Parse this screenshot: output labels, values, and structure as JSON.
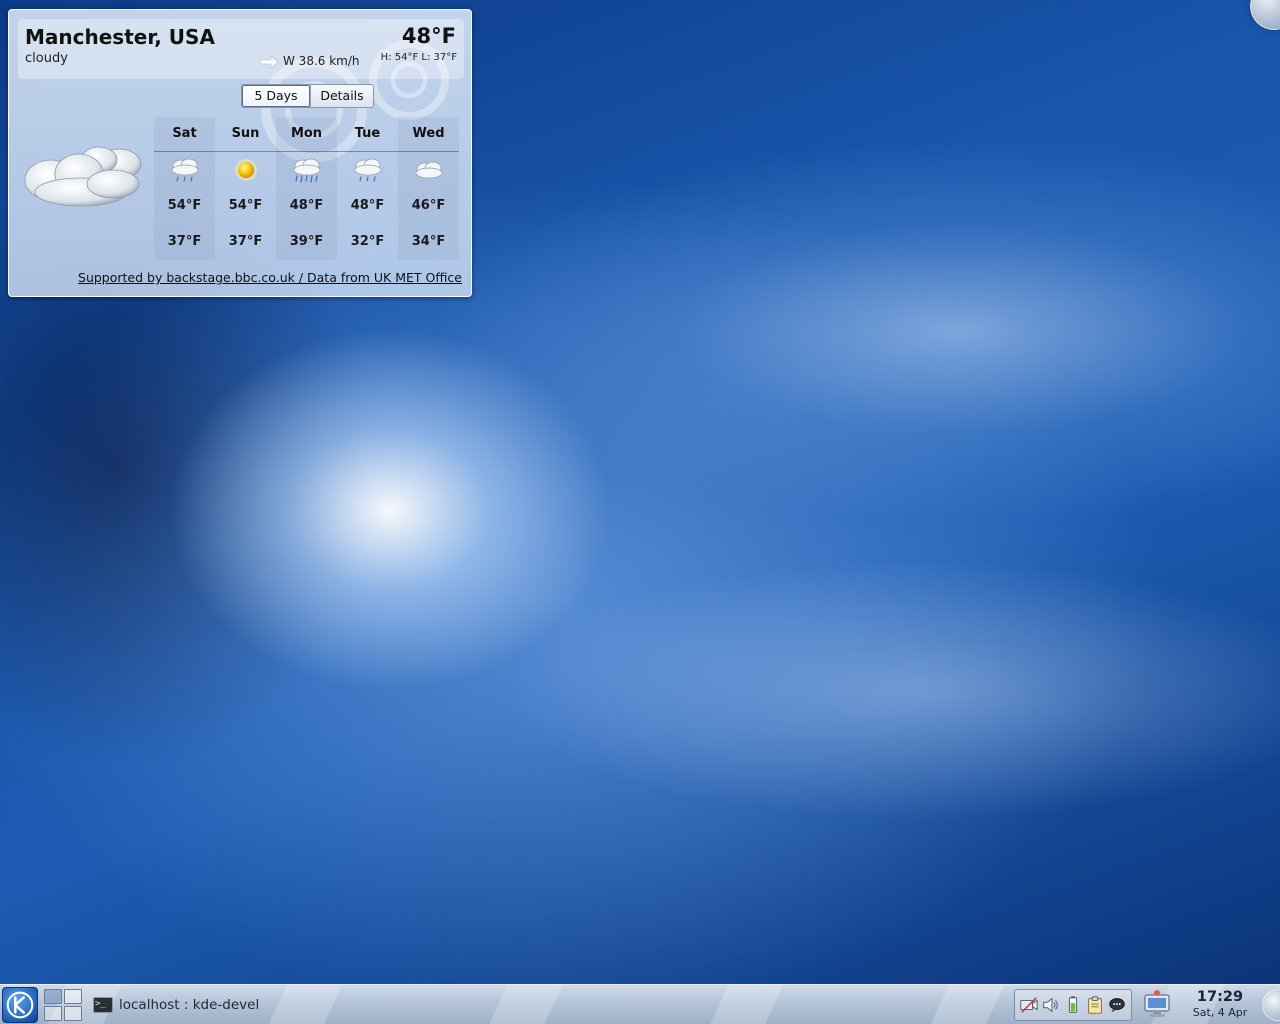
{
  "weather": {
    "city": "Manchester, USA",
    "condition": "cloudy",
    "temperature": "48°F",
    "wind": "W 38.6 km/h",
    "hilo": "H: 54°F L: 37°F",
    "tabs": {
      "days": "5 Days",
      "details": "Details"
    },
    "forecast": [
      {
        "day": "Sat",
        "icon": "light-rain-icon",
        "hi": "54°F",
        "lo": "37°F"
      },
      {
        "day": "Sun",
        "icon": "sunny-icon",
        "hi": "54°F",
        "lo": "37°F"
      },
      {
        "day": "Mon",
        "icon": "heavy-rain-icon",
        "hi": "48°F",
        "lo": "39°F"
      },
      {
        "day": "Tue",
        "icon": "light-rain-icon",
        "hi": "48°F",
        "lo": "32°F"
      },
      {
        "day": "Wed",
        "icon": "cloudy-icon",
        "hi": "46°F",
        "lo": "34°F"
      }
    ],
    "credits": "Supported by backstage.bbc.co.uk / Data from UK MET Office"
  },
  "panel": {
    "task_label": "localhost : kde-devel",
    "clock_time": "17:29",
    "clock_date": "Sat, 4 Apr"
  }
}
